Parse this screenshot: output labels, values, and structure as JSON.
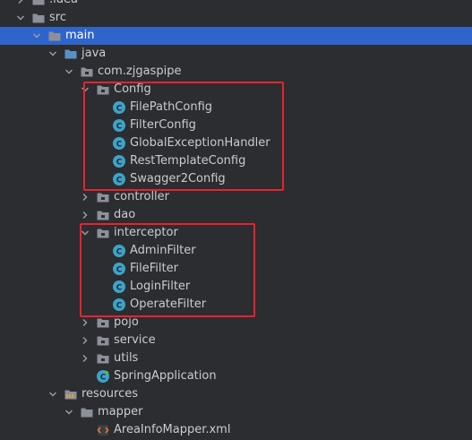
{
  "tree": {
    "items": [
      {
        "label": ".idea",
        "icon": "folder-icon",
        "state": "collapsed"
      },
      {
        "label": "src",
        "icon": "folder-icon",
        "state": "expanded"
      },
      {
        "label": "main",
        "icon": "folder-icon",
        "state": "expanded",
        "selected": true
      },
      {
        "label": "java",
        "icon": "source-folder-icon",
        "state": "expanded"
      },
      {
        "label": "com.zjgaspipe",
        "icon": "package-icon",
        "state": "expanded"
      },
      {
        "label": "Config",
        "icon": "package-icon",
        "state": "expanded"
      },
      {
        "label": "FilePathConfig",
        "icon": "class-icon"
      },
      {
        "label": "FilterConfig",
        "icon": "class-icon"
      },
      {
        "label": "GlobalExceptionHandler",
        "icon": "class-icon"
      },
      {
        "label": "RestTemplateConfig",
        "icon": "class-icon"
      },
      {
        "label": "Swagger2Config",
        "icon": "class-icon"
      },
      {
        "label": "controller",
        "icon": "package-icon",
        "state": "collapsed"
      },
      {
        "label": "dao",
        "icon": "package-icon",
        "state": "collapsed"
      },
      {
        "label": "interceptor",
        "icon": "package-icon",
        "state": "expanded"
      },
      {
        "label": "AdminFilter",
        "icon": "class-icon"
      },
      {
        "label": "FileFilter",
        "icon": "class-icon"
      },
      {
        "label": "LoginFilter",
        "icon": "class-icon"
      },
      {
        "label": "OperateFilter",
        "icon": "class-icon"
      },
      {
        "label": "pojo",
        "icon": "package-icon",
        "state": "collapsed"
      },
      {
        "label": "service",
        "icon": "package-icon",
        "state": "collapsed"
      },
      {
        "label": "utils",
        "icon": "package-icon",
        "state": "collapsed"
      },
      {
        "label": "SpringApplication",
        "icon": "spring-boot-class-icon"
      },
      {
        "label": "resources",
        "icon": "resources-folder-icon",
        "state": "expanded"
      },
      {
        "label": "mapper",
        "icon": "folder-icon",
        "state": "expanded"
      },
      {
        "label": "AreaInfoMapper.xml",
        "icon": "xml-file-icon"
      }
    ]
  },
  "colors": {
    "background": "#2b2d30",
    "selection": "#2f65ca",
    "highlight_box": "#e8232e",
    "class_icon": "#3da3c9",
    "folder": "#8c9099"
  }
}
